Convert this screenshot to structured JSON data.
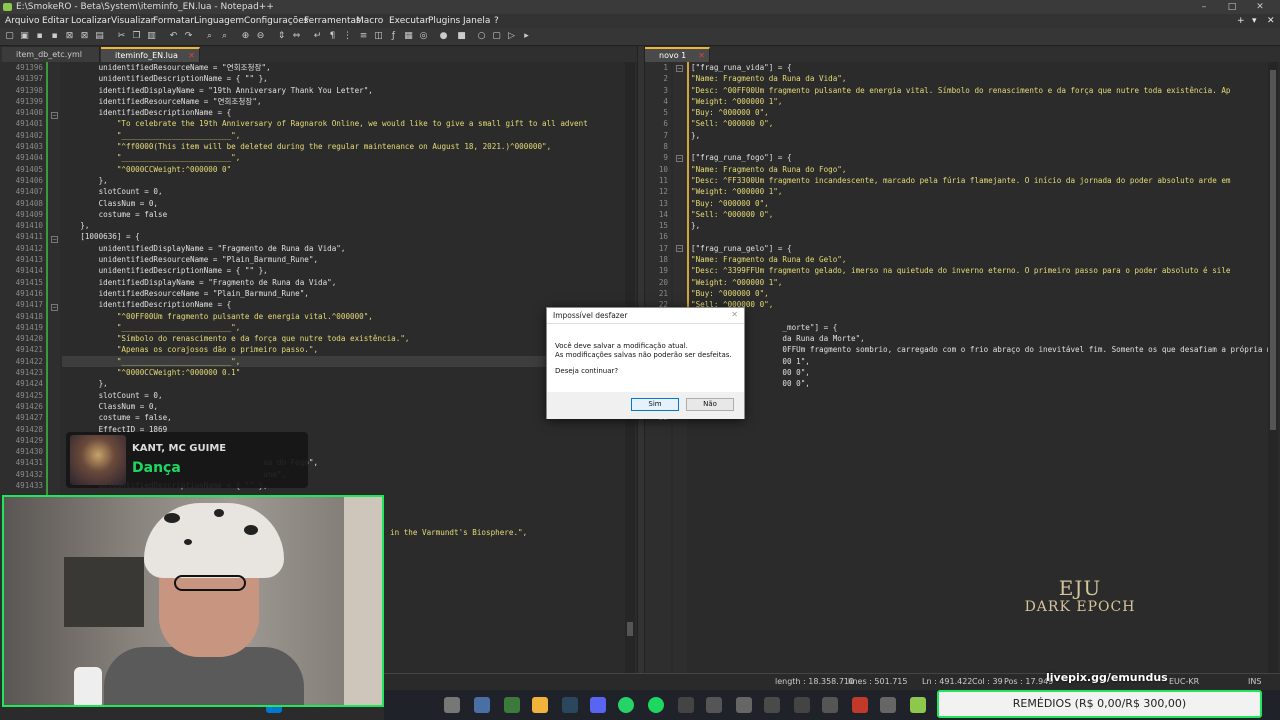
{
  "window": {
    "title": "E:\\SmokeRO - Beta\\System\\iteminfo_EN.lua - Notepad++"
  },
  "menu": [
    "Arquivo",
    "Editar",
    "Localizar",
    "Visualizar",
    "Formatar",
    "Linguagem",
    "Configurações",
    "Ferramentas",
    "Macro",
    "Executar",
    "Plugins",
    "Janela",
    "?"
  ],
  "left_tabs": [
    "item_db_etc.yml",
    "iteminfo_EN.lua"
  ],
  "right_tabs": [
    "novo 1"
  ],
  "left_editor": {
    "line_numbers": [
      "491396",
      "491397",
      "491398",
      "491399",
      "491400",
      "491401",
      "491402",
      "491403",
      "491404",
      "491405",
      "491406",
      "491407",
      "491408",
      "491409",
      "491410",
      "491411",
      "491412",
      "491413",
      "491414",
      "491415",
      "491416",
      "491417",
      "491418",
      "491419",
      "491420",
      "491421",
      "491422",
      "491423",
      "491424",
      "491425",
      "491426",
      "491427",
      "491428",
      "491429",
      "491430",
      "491431",
      "491432",
      "491433"
    ],
    "lines": [
      "        unidentifiedResourceName = \"연회조청장\",",
      "        unidentifiedDescriptionName = { \"\" },",
      "        identifiedDisplayName = \"19th Anniversary Thank You Letter\",",
      "        identifiedResourceName = \"연회조청장\",",
      "        identifiedDescriptionName = {",
      "            \"To celebrate the 19th Anniversary of Ragnarok Online, we would like to give a small gift to all advent",
      "            \"________________________\",",
      "            \"^ff0000(This item will be deleted during the regular maintenance on August 18, 2021.)^000000\",",
      "            \"________________________\",",
      "            \"^0000CCWeight:^000000 0\"",
      "        },",
      "        slotCount = 0,",
      "        ClassNum = 0,",
      "        costume = false",
      "    },",
      "    [1000636] = {",
      "        unidentifiedDisplayName = \"Fragmento de Runa da Vida\",",
      "        unidentifiedResourceName = \"Plain_Barmund_Rune\",",
      "        unidentifiedDescriptionName = { \"\" },",
      "        identifiedDisplayName = \"Fragmento de Runa da Vida\",",
      "        identifiedResourceName = \"Plain_Barmund_Rune\",",
      "        identifiedDescriptionName = {",
      "            \"^00FF00Um fragmento pulsante de energia vital.^000000\",",
      "            \"________________________\",",
      "            \"Símbolo do renascimento e da força que nutre toda existência.\",",
      "            \"Apenas os corajosos dão o primeiro passo.\",",
      "            \"________________________\",",
      "            \"^0000CCWeight:^000000 0.1\"",
      "        },",
      "        slotCount = 0,",
      "        ClassNum = 0,",
      "        costume = false,",
      "        EffectID = 1869",
      "",
      "",
      "                                            na do Fogo\",",
      "                                            une\",",
      "        unidentifiedDescriptionName = { \"\" },"
    ],
    "tail_text": "in the Varmundt's Biosphere.\","
  },
  "right_editor": {
    "line_numbers": [
      "1",
      "2",
      "3",
      "4",
      "5",
      "6",
      "7",
      "8",
      "9",
      "10",
      "11",
      "12",
      "13",
      "14",
      "15",
      "16",
      "17",
      "18",
      "19",
      "20",
      "21",
      "22",
      "23",
      "24",
      "25",
      "26",
      "27",
      "28",
      "29",
      "30",
      "31",
      "32"
    ],
    "lines": [
      "[\"frag_runa_vida\"] = {",
      "\"Name: Fragmento da Runa da Vida\",",
      "\"Desc: ^00FF00Um fragmento pulsante de energia vital. Símbolo do renascimento e da força que nutre toda existência. Ap",
      "\"Weight: ^000000 1\",",
      "\"Buy: ^000000 0\",",
      "\"Sell: ^000000 0\",",
      "},",
      "",
      "[\"frag_runa_fogo\"] = {",
      "\"Name: Fragmento da Runa do Fogo\",",
      "\"Desc: ^FF3300Um fragmento incandescente, marcado pela fúria flamejante. O início da jornada do poder absoluto arde em",
      "\"Weight: ^000000 1\",",
      "\"Buy: ^000000 0\",",
      "\"Sell: ^000000 0\",",
      "},",
      "",
      "[\"frag_runa_gelo\"] = {",
      "\"Name: Fragmento da Runa de Gelo\",",
      "\"Desc: ^3399FFUm fragmento gelado, imerso na quietude do inverno eterno. O primeiro passo para o poder absoluto é sile",
      "\"Weight: ^000000 1\",",
      "\"Buy: ^000000 0\",",
      "\"Sell: ^000000 0\",",
      "",
      "                    _morte\"] = {",
      "                    da Runa da Morte\",",
      "                    0FFUm fragmento sombrio, carregado com o frio abraço do inevitável fim. Somente os que desafiam a própria m",
      "                    00 1\",",
      "                    00 0\",",
      "                    00 0\",",
      "",
      "",
      ""
    ]
  },
  "dialog": {
    "title": "Impossível desfazer",
    "message_line1": "Você deve salvar a modificação atual.",
    "message_line2": "As modificações salvas não poderão ser desfeitas.",
    "question": "Deseja continuar?",
    "yes": "Sim",
    "no": "Não"
  },
  "statusbar": {
    "length": "length : 18.358.710",
    "lines": "lines : 501.715",
    "ln": "Ln : 491.422",
    "col": "Col : 39",
    "pos": "Pos : 17.949",
    "encoding": "EUC-KR",
    "ins": "INS"
  },
  "now_playing": {
    "artist": "KANT, MC GUIME",
    "song": "Dança"
  },
  "overlay": {
    "livepix": "livepix.gg/emundus",
    "goal": "REMÉDIOS (R$ 0,00/R$ 300,00)",
    "brand_line1": "EJU",
    "brand_line2": "DARK EPOCH"
  },
  "colors": {
    "accent": "#f0b33b",
    "spotify_green": "#1ed760",
    "stream_border": "#1ee85a"
  }
}
